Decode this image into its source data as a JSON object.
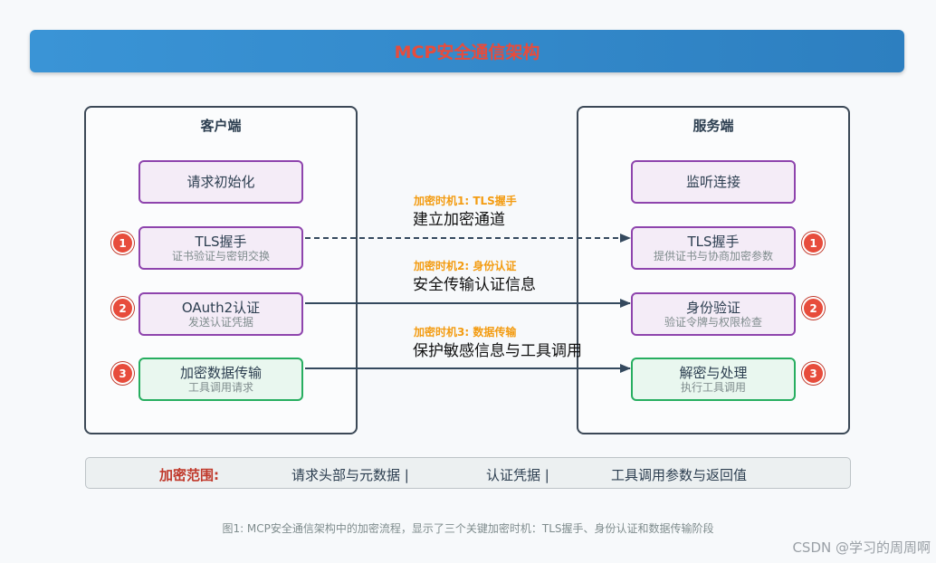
{
  "title": "MCP安全通信架构",
  "client": {
    "title": "客户端",
    "boxes": [
      {
        "main": "请求初始化",
        "sub": ""
      },
      {
        "main": "TLS握手",
        "sub": "证书验证与密钥交换",
        "badge": "1"
      },
      {
        "main": "OAuth2认证",
        "sub": "发送认证凭据",
        "badge": "2"
      },
      {
        "main": "加密数据传输",
        "sub": "工具调用请求",
        "badge": "3"
      }
    ]
  },
  "server": {
    "title": "服务端",
    "boxes": [
      {
        "main": "监听连接",
        "sub": ""
      },
      {
        "main": "TLS握手",
        "sub": "提供证书与协商加密参数",
        "badge": "1"
      },
      {
        "main": "身份验证",
        "sub": "验证令牌与权限检查",
        "badge": "2"
      },
      {
        "main": "解密与处理",
        "sub": "执行工具调用",
        "badge": "3"
      }
    ]
  },
  "timings": [
    {
      "label": "加密时机1: TLS握手",
      "desc": "建立加密通道"
    },
    {
      "label": "加密时机2: 身份认证",
      "desc": "安全传输认证信息"
    },
    {
      "label": "加密时机3: 数据传输",
      "desc": "保护敏感信息与工具调用"
    }
  ],
  "scope": {
    "label": "加密范围:",
    "items": [
      "请求头部与元数据 |",
      "认证凭据 |",
      "工具调用参数与返回值"
    ]
  },
  "caption": "图1: MCP安全通信架构中的加密流程，显示了三个关键加密时机：TLS握手、身份认证和数据传输阶段",
  "watermark": "CSDN @学习的周周啊",
  "colors": {
    "title_bar": "#3a94d6",
    "title_text": "#e74c3c",
    "purple_border": "#8e44ad",
    "green_border": "#27ae60",
    "badge": "#e74c3c",
    "timing_label": "#f39c12",
    "arrow": "#34495e"
  }
}
